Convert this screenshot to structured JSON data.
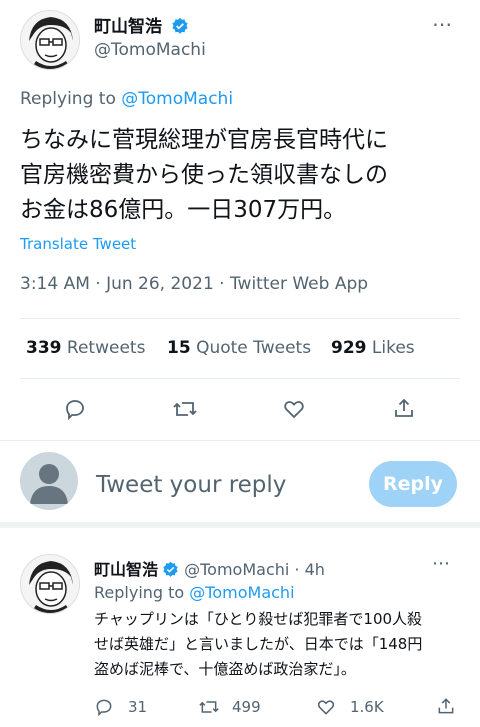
{
  "tweet": {
    "author_name": "町山智浩",
    "author_handle": "@TomoMachi",
    "replying_prefix": "Replying to",
    "replying_handle": "@TomoMachi",
    "text_line1": "ちなみに菅現総理が官房長官時代に",
    "text_line2": "官房機密費から使った領収書なしの",
    "text_line3": "お金は86億円。一日307万円。",
    "translate": "Translate Tweet",
    "meta": "3:14 AM · Jun 26, 2021 · Twitter Web App",
    "stats": {
      "retweets_count": "339",
      "retweets_label": "Retweets",
      "quotes_count": "15",
      "quotes_label": "Quote Tweets",
      "likes_count": "929",
      "likes_label": "Likes"
    }
  },
  "composer": {
    "placeholder": "Tweet your reply",
    "button": "Reply"
  },
  "reply": {
    "author_name": "町山智浩",
    "author_handle": "@TomoMachi",
    "time": "· 4h",
    "replying_prefix": "Replying to",
    "replying_handle": "@TomoMachi",
    "text_line1": "チャップリンは「ひとり殺せば犯罪者で100人殺",
    "text_line2": "せば英雄だ」と言いましたが、日本では「148円",
    "text_line3": "盗めば泥棒で、十億盗めば政治家だ」。",
    "replies": "31",
    "retweets": "499",
    "likes": "1.6K"
  },
  "colors": {
    "accent": "#1d9bf0",
    "muted": "#536471",
    "button_disabled": "#9fd2f7"
  }
}
